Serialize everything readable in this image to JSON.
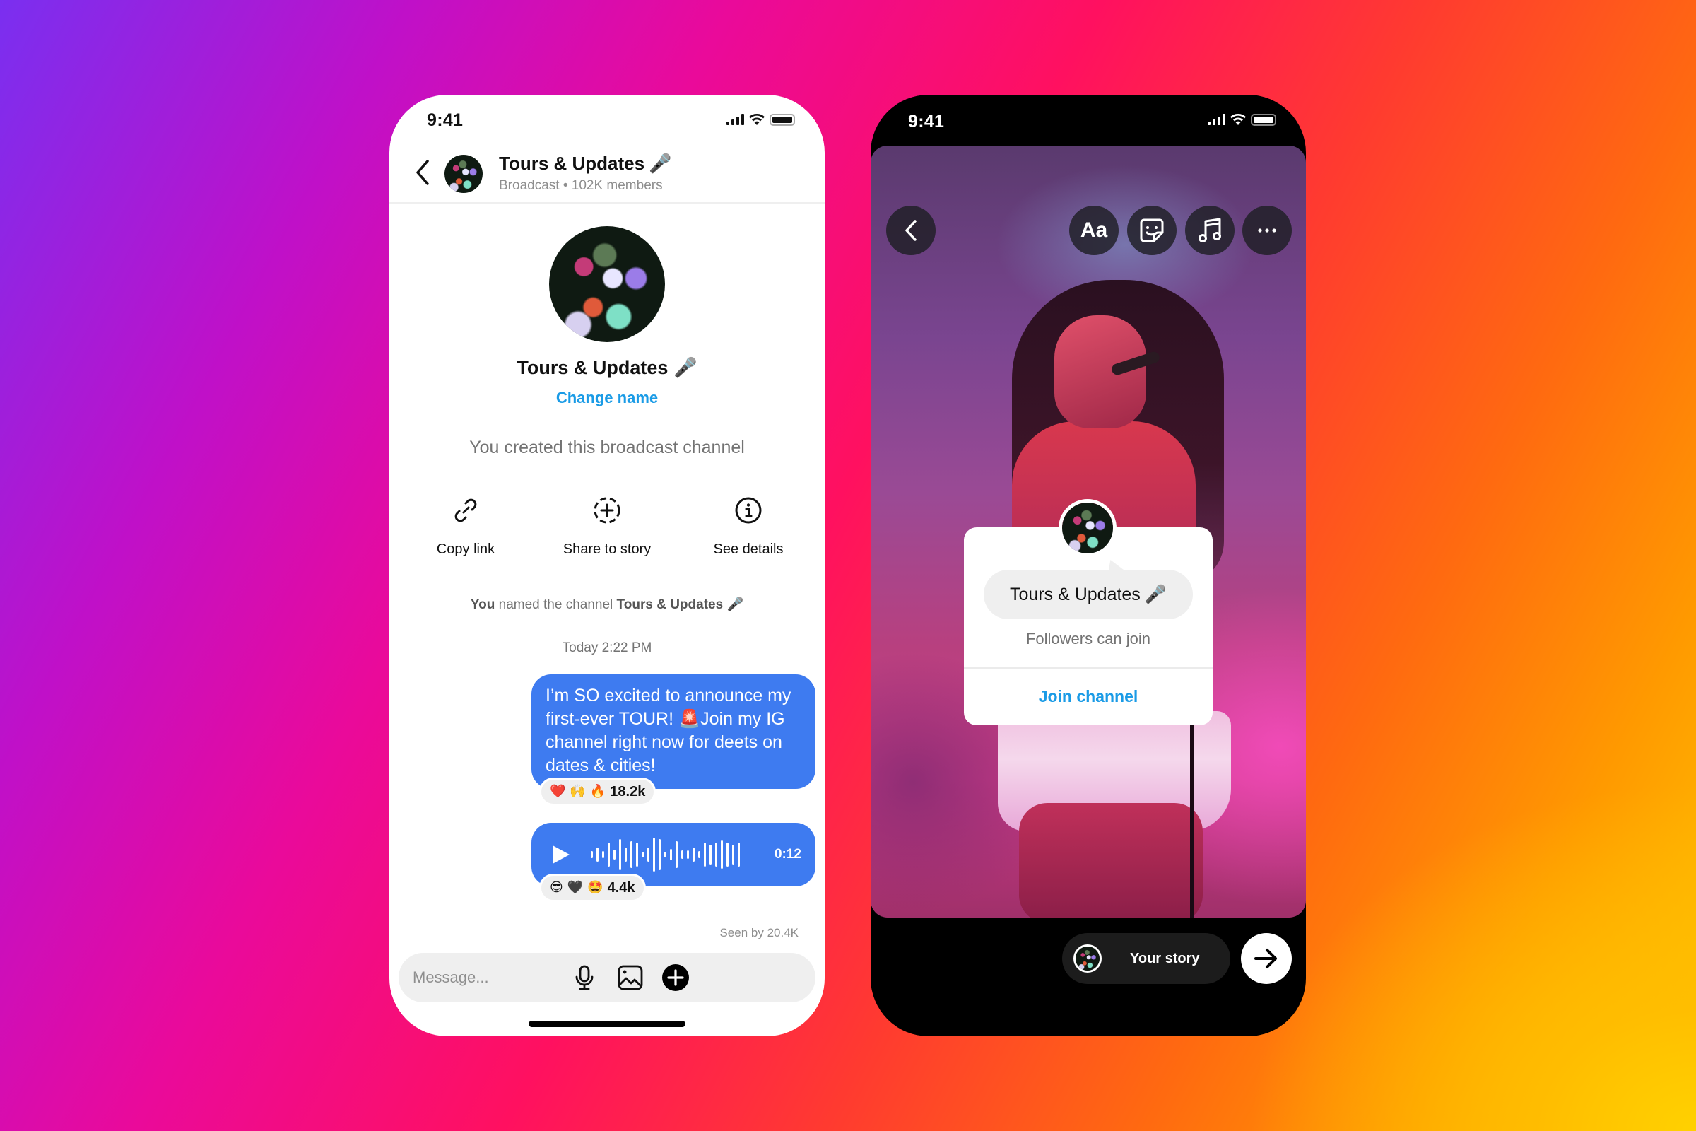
{
  "background": {
    "gradient_colors": [
      "#7a2ff0",
      "#c010c8",
      "#ea0a9a",
      "#ff1060",
      "#ff6a10",
      "#ffc800"
    ]
  },
  "accent_colors": {
    "bubble_blue": "#3e7bf0",
    "link_blue": "#1a9be6"
  },
  "left_phone": {
    "status_bar": {
      "time": "9:41"
    },
    "header": {
      "title": "Tours & Updates",
      "title_icon": "microphone-emoji",
      "subtitle": "Broadcast • 102K members"
    },
    "profile": {
      "name": "Tours & Updates",
      "change_name_label": "Change name",
      "created_note": "You created this broadcast channel"
    },
    "actions": [
      {
        "label": "Copy link",
        "icon": "link-icon"
      },
      {
        "label": "Share to story",
        "icon": "add-story-icon"
      },
      {
        "label": "See details",
        "icon": "info-icon"
      }
    ],
    "system_note": {
      "prefix": "You",
      "middle": " named the channel ",
      "channel": "Tours & Updates"
    },
    "timestamp": "Today 2:22 PM",
    "messages": [
      {
        "type": "text",
        "text_part1": "I’m SO excited to announce my first-ever TOUR! ",
        "emoji": "🚨",
        "text_part2": "Join my IG channel right now for deets on dates & cities!",
        "reactions": [
          "❤️",
          "🙌",
          "🔥"
        ],
        "reaction_count": "18.2k"
      },
      {
        "type": "voice",
        "duration": "0:12",
        "reactions": [
          "😎",
          "🖤",
          "🤩"
        ],
        "reaction_count": "4.4k"
      }
    ],
    "seen_by": "Seen by 20.4K",
    "composer": {
      "placeholder": "Message...",
      "value": ""
    }
  },
  "right_phone": {
    "status_bar": {
      "time": "9:41"
    },
    "toolbar": {
      "text_button_label": "Aa",
      "buttons": [
        "back-icon",
        "text-tool",
        "sticker-icon",
        "music-icon",
        "more-icon"
      ]
    },
    "channel_sticker": {
      "name": "Tours & Updates",
      "subtitle": "Followers can join",
      "join_label": "Join channel"
    },
    "share": {
      "your_story_label": "Your story"
    }
  }
}
